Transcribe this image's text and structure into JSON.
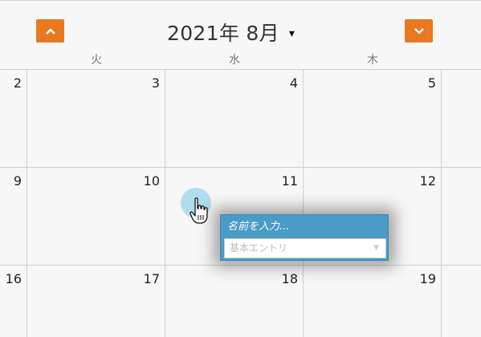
{
  "header": {
    "title": "2021年 8月",
    "title_caret": "▾",
    "prev_icon": "chevron-up-icon",
    "next_icon": "chevron-down-icon",
    "accent_color": "#e9781f"
  },
  "weekdays": [
    "火",
    "水",
    "木"
  ],
  "weeks": [
    [
      "2",
      "3",
      "4",
      "5"
    ],
    [
      "9",
      "10",
      "11",
      "12"
    ],
    [
      "16",
      "17",
      "18",
      "19"
    ]
  ],
  "popup": {
    "name_placeholder": "名前を入力...",
    "entry_type": "基本エントリ",
    "accent_color": "#4a9bc5"
  }
}
